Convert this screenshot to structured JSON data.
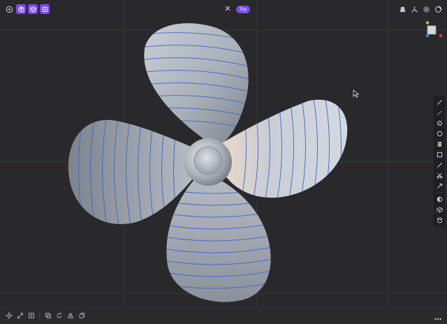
{
  "view": {
    "label": "Top"
  },
  "colors": {
    "accent": "#7b4cf0",
    "background": "#29292c",
    "x_axis": "#7a2a2a",
    "blade_lines": "#3a66c8",
    "gizmo_x": "#e03246",
    "gizmo_y": "#8ccf3c",
    "gizmo_z": "#3c84e0"
  },
  "toolbar_left": {
    "icons": [
      "target-icon",
      "extrude-icon",
      "cube-icon",
      "frame-icon"
    ]
  },
  "toolbar_center": {
    "close": "✕"
  },
  "toolbar_right": {
    "icons": [
      "perspective-icon",
      "axes-icon",
      "gear-icon",
      "circle-icon"
    ]
  },
  "right_tools": [
    "line-tool",
    "line-pattern-tool",
    "point-tool",
    "circle-tool",
    "stack-tool",
    "rectangle-tool",
    "curve-tool",
    "cut-tool",
    "trim-tool",
    "shade-tool",
    "box-tool",
    "cylinder-tool"
  ],
  "bottom_tools": [
    "move-tool",
    "scale-tool",
    "grid-tool",
    "duplicate-tool",
    "rotate-tool",
    "mirror-tool",
    "copy-tool"
  ],
  "bottom_more": "•••"
}
